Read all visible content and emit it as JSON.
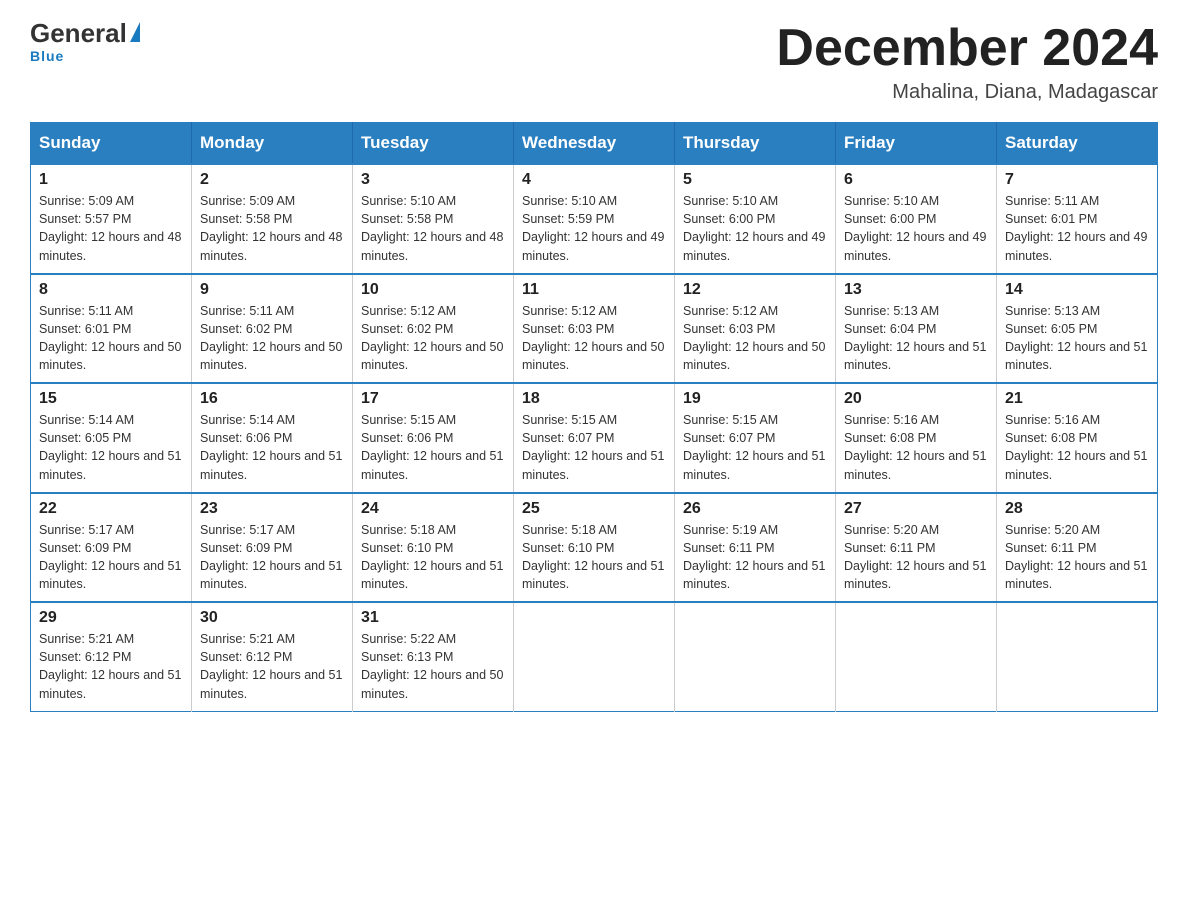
{
  "header": {
    "logo_general": "General",
    "logo_blue": "Blue",
    "logo_tagline": "Blue",
    "month_title": "December 2024",
    "location": "Mahalina, Diana, Madagascar"
  },
  "weekdays": [
    "Sunday",
    "Monday",
    "Tuesday",
    "Wednesday",
    "Thursday",
    "Friday",
    "Saturday"
  ],
  "weeks": [
    [
      {
        "day": "1",
        "sunrise": "5:09 AM",
        "sunset": "5:57 PM",
        "daylight": "12 hours and 48 minutes."
      },
      {
        "day": "2",
        "sunrise": "5:09 AM",
        "sunset": "5:58 PM",
        "daylight": "12 hours and 48 minutes."
      },
      {
        "day": "3",
        "sunrise": "5:10 AM",
        "sunset": "5:58 PM",
        "daylight": "12 hours and 48 minutes."
      },
      {
        "day": "4",
        "sunrise": "5:10 AM",
        "sunset": "5:59 PM",
        "daylight": "12 hours and 49 minutes."
      },
      {
        "day": "5",
        "sunrise": "5:10 AM",
        "sunset": "6:00 PM",
        "daylight": "12 hours and 49 minutes."
      },
      {
        "day": "6",
        "sunrise": "5:10 AM",
        "sunset": "6:00 PM",
        "daylight": "12 hours and 49 minutes."
      },
      {
        "day": "7",
        "sunrise": "5:11 AM",
        "sunset": "6:01 PM",
        "daylight": "12 hours and 49 minutes."
      }
    ],
    [
      {
        "day": "8",
        "sunrise": "5:11 AM",
        "sunset": "6:01 PM",
        "daylight": "12 hours and 50 minutes."
      },
      {
        "day": "9",
        "sunrise": "5:11 AM",
        "sunset": "6:02 PM",
        "daylight": "12 hours and 50 minutes."
      },
      {
        "day": "10",
        "sunrise": "5:12 AM",
        "sunset": "6:02 PM",
        "daylight": "12 hours and 50 minutes."
      },
      {
        "day": "11",
        "sunrise": "5:12 AM",
        "sunset": "6:03 PM",
        "daylight": "12 hours and 50 minutes."
      },
      {
        "day": "12",
        "sunrise": "5:12 AM",
        "sunset": "6:03 PM",
        "daylight": "12 hours and 50 minutes."
      },
      {
        "day": "13",
        "sunrise": "5:13 AM",
        "sunset": "6:04 PM",
        "daylight": "12 hours and 51 minutes."
      },
      {
        "day": "14",
        "sunrise": "5:13 AM",
        "sunset": "6:05 PM",
        "daylight": "12 hours and 51 minutes."
      }
    ],
    [
      {
        "day": "15",
        "sunrise": "5:14 AM",
        "sunset": "6:05 PM",
        "daylight": "12 hours and 51 minutes."
      },
      {
        "day": "16",
        "sunrise": "5:14 AM",
        "sunset": "6:06 PM",
        "daylight": "12 hours and 51 minutes."
      },
      {
        "day": "17",
        "sunrise": "5:15 AM",
        "sunset": "6:06 PM",
        "daylight": "12 hours and 51 minutes."
      },
      {
        "day": "18",
        "sunrise": "5:15 AM",
        "sunset": "6:07 PM",
        "daylight": "12 hours and 51 minutes."
      },
      {
        "day": "19",
        "sunrise": "5:15 AM",
        "sunset": "6:07 PM",
        "daylight": "12 hours and 51 minutes."
      },
      {
        "day": "20",
        "sunrise": "5:16 AM",
        "sunset": "6:08 PM",
        "daylight": "12 hours and 51 minutes."
      },
      {
        "day": "21",
        "sunrise": "5:16 AM",
        "sunset": "6:08 PM",
        "daylight": "12 hours and 51 minutes."
      }
    ],
    [
      {
        "day": "22",
        "sunrise": "5:17 AM",
        "sunset": "6:09 PM",
        "daylight": "12 hours and 51 minutes."
      },
      {
        "day": "23",
        "sunrise": "5:17 AM",
        "sunset": "6:09 PM",
        "daylight": "12 hours and 51 minutes."
      },
      {
        "day": "24",
        "sunrise": "5:18 AM",
        "sunset": "6:10 PM",
        "daylight": "12 hours and 51 minutes."
      },
      {
        "day": "25",
        "sunrise": "5:18 AM",
        "sunset": "6:10 PM",
        "daylight": "12 hours and 51 minutes."
      },
      {
        "day": "26",
        "sunrise": "5:19 AM",
        "sunset": "6:11 PM",
        "daylight": "12 hours and 51 minutes."
      },
      {
        "day": "27",
        "sunrise": "5:20 AM",
        "sunset": "6:11 PM",
        "daylight": "12 hours and 51 minutes."
      },
      {
        "day": "28",
        "sunrise": "5:20 AM",
        "sunset": "6:11 PM",
        "daylight": "12 hours and 51 minutes."
      }
    ],
    [
      {
        "day": "29",
        "sunrise": "5:21 AM",
        "sunset": "6:12 PM",
        "daylight": "12 hours and 51 minutes."
      },
      {
        "day": "30",
        "sunrise": "5:21 AM",
        "sunset": "6:12 PM",
        "daylight": "12 hours and 51 minutes."
      },
      {
        "day": "31",
        "sunrise": "5:22 AM",
        "sunset": "6:13 PM",
        "daylight": "12 hours and 50 minutes."
      },
      null,
      null,
      null,
      null
    ]
  ]
}
